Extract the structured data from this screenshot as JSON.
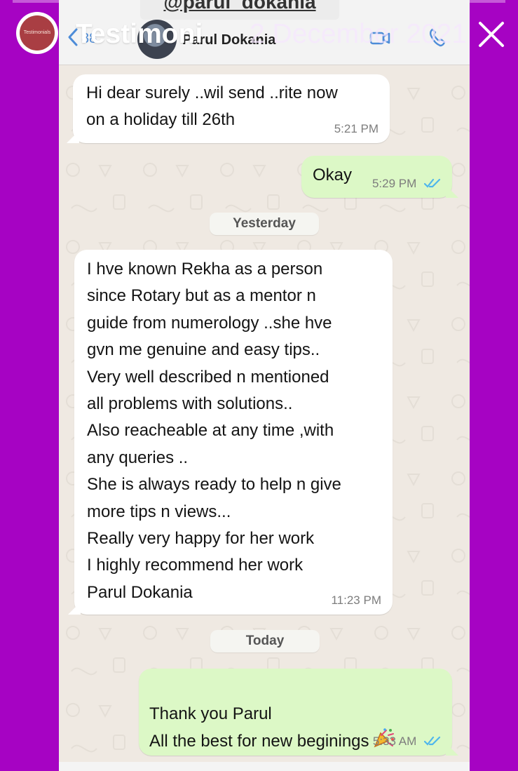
{
  "story": {
    "account_logo_text": "Testimonials",
    "title": "Testimoni",
    "date": "2 December 2021"
  },
  "chat": {
    "handle": "@parul_dokania",
    "back_count": "88",
    "contact_name": "Parul Dokania",
    "messages": [
      {
        "direction": "incoming",
        "text": "Hi dear surely ..wil send ..rite now\non  a holiday till 26th",
        "time": "5:21 PM"
      },
      {
        "direction": "outgoing",
        "text": "Okay",
        "time": "5:29 PM",
        "status": "read"
      },
      {
        "direction": "date",
        "text": "Yesterday"
      },
      {
        "direction": "incoming",
        "text": "I hve known Rekha as a person\nsince Rotary but as a mentor n\nguide from numerology ..she hve\ngvn me genuine and easy tips..\nVery well described n mentioned\nall problems with solutions..\nAlso reacheable at any time ,with\nany queries ..\nShe is always ready to help n give\nmore tips n views...\nReally very happy for her work\nI highly recommend her work\nParul Dokania",
        "time": "11:23 PM"
      },
      {
        "direction": "date",
        "text": "Today"
      },
      {
        "direction": "outgoing",
        "text": "Thank you Parul\nAll the best for new beginings",
        "time": "5:33 AM",
        "status": "read",
        "emoji": "party-popper"
      }
    ]
  },
  "colors": {
    "story_background": "#a603c3",
    "incoming_bubble": "#ffffff",
    "outgoing_bubble": "#dcf8c6",
    "chat_background": "#efe9e2",
    "read_ticks": "#4fb6ec"
  }
}
